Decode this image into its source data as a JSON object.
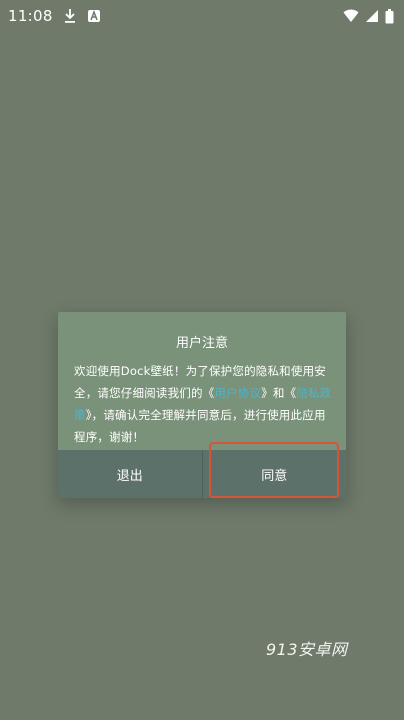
{
  "status_bar": {
    "time": "11:08",
    "icons_left": [
      "download-icon",
      "app-a-icon"
    ],
    "icons_right": [
      "wifi-icon",
      "signal-icon",
      "battery-icon"
    ]
  },
  "dialog": {
    "title": "用户注意",
    "body_segments": [
      {
        "text": "欢迎使用Dock壁纸！为了保护您的隐私和使用安全，请您仔细阅读我们的《",
        "link": false
      },
      {
        "text": "用户协议",
        "link": true
      },
      {
        "text": "》和《",
        "link": false
      },
      {
        "text": "隐私政策",
        "link": true
      },
      {
        "text": "》，请确认完全理解并同意后，进行使用此应用程序，谢谢！",
        "link": false
      }
    ],
    "exit_label": "退出",
    "agree_label": "同意"
  },
  "watermark": {
    "text": "913安卓网"
  },
  "colors": {
    "background": "#6f7a6b",
    "dialog": "#7a927a",
    "buttons": "#5d716b",
    "link": "#4fb3c9",
    "highlight": "#d5553a"
  }
}
